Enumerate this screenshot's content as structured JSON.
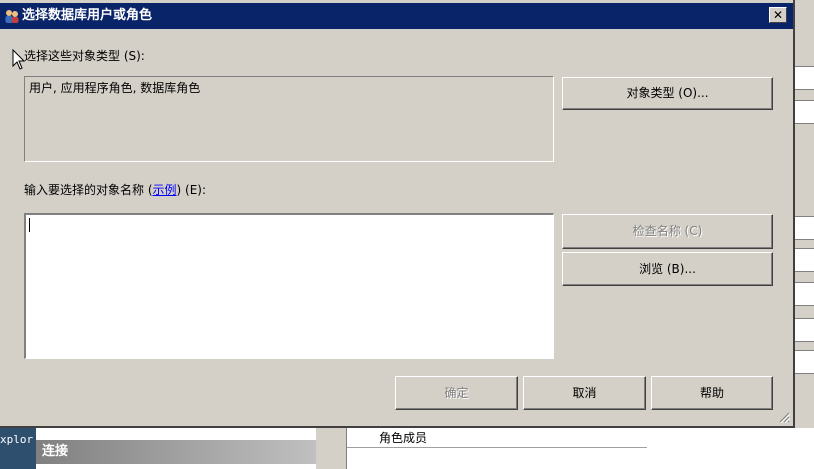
{
  "dialog": {
    "title": "选择数据库用户或角色",
    "close_label": "✕",
    "object_types_label": "选择这些对象类型 (S):",
    "object_types_value": "用户, 应用程序角色, 数据库角色",
    "object_types_button": "对象类型 (O)...",
    "names_label_prefix": "输入要选择的对象名称 (",
    "names_label_link": "示例",
    "names_label_suffix": ") (E):",
    "names_input_value": "",
    "check_names_button": "检查名称 (C)",
    "browse_button": "浏览 (B)...",
    "ok_button": "确定",
    "cancel_button": "取消",
    "help_button": "帮助"
  },
  "background": {
    "explorer_tab_label": "xplor",
    "connect_header": "连接",
    "role_members_header": "角色成员"
  }
}
